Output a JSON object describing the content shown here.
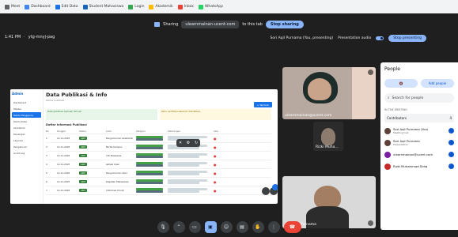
{
  "bookmarks": [
    "Meet",
    "Dashboard",
    "Edit Data",
    "Student Mahasiswa",
    "Login",
    "Akademik",
    "Inbox",
    "WhatsApp"
  ],
  "share_banner": {
    "label": "Sharing",
    "link": "ulearnmainan-ucent-com",
    "to_this_tab": "to this tab",
    "stop": "Stop sharing"
  },
  "meeting": {
    "time": "1:41 PM",
    "code": "ytg-mnyj-pag"
  },
  "status": {
    "presenter": "Sori Aqil Purnama (You, presenting)",
    "audio_label": "Presentation audio",
    "stop_presenting": "Stop presenting"
  },
  "shared_app": {
    "logo": "Admin",
    "sidebar": [
      "Dashboard",
      "Master",
      "Kelola Pengguna",
      "Kelola Data",
      "Akademik",
      "Keuangan",
      "Laporan",
      "Pengaturan",
      "Audit Log"
    ],
    "title": "Data Publikasi & Info",
    "subtitle": "Kelola publikasi",
    "add_button": "+ Tambah",
    "notes": [
      "Data publikasi berhasil dimuat",
      "Perlu verifikasi sebelum diterbitkan"
    ],
    "section": "Daftar Informasi Publikasi",
    "headers": [
      "No",
      "Tanggal",
      "Status",
      "Judul",
      "Kategori",
      "Keterangan",
      "Aksi"
    ],
    "rows": [
      {
        "no": "1",
        "date": "12-11-2025",
        "status": "Aktif",
        "title": "Pengumuman Akademik"
      },
      {
        "no": "2",
        "date": "12-11-2025",
        "status": "Aktif",
        "title": "Berita Kampus"
      },
      {
        "no": "3",
        "date": "12-11-2025",
        "status": "Aktif",
        "title": "Info Beasiswa"
      },
      {
        "no": "4",
        "date": "12-11-2025",
        "status": "Aktif",
        "title": "Jadwal Ujian"
      },
      {
        "no": "5",
        "date": "12-11-2025",
        "status": "Aktif",
        "title": "Pengumuman Libur"
      },
      {
        "no": "6",
        "date": "12-11-2025",
        "status": "Aktif",
        "title": "Kegiatan Mahasiswa"
      },
      {
        "no": "7",
        "date": "12-11-2025",
        "status": "Aktif",
        "title": "Informasi Umum"
      }
    ]
  },
  "participants": [
    {
      "name": "ulearnmainan@ucent.com"
    },
    {
      "name": "Rizki Muha..."
    },
    {
      "name": "Sori Aqil Purnama"
    }
  ],
  "people_panel": {
    "title": "People",
    "add_people": "Add people",
    "search_placeholder": "Search for people",
    "in_meeting": "IN THE MEETING",
    "contributors": "Contributors",
    "contributors_count": "4",
    "list": [
      {
        "name": "Sori Aqil Purnama (You)",
        "role": "Meeting host",
        "color": "#5d4037"
      },
      {
        "name": "Sori Aqil Purnama",
        "role": "Presentation",
        "color": "#5d4037"
      },
      {
        "name": "ulearnmainan@ucent.com",
        "role": "",
        "color": "#7b1fa2"
      },
      {
        "name": "Rizki Muhammad Sidiq",
        "role": "",
        "color": "#c62828"
      }
    ]
  },
  "controls": [
    "mic",
    "expand",
    "camera",
    "present",
    "emoji",
    "captions",
    "raise-hand",
    "more",
    "end-call"
  ]
}
